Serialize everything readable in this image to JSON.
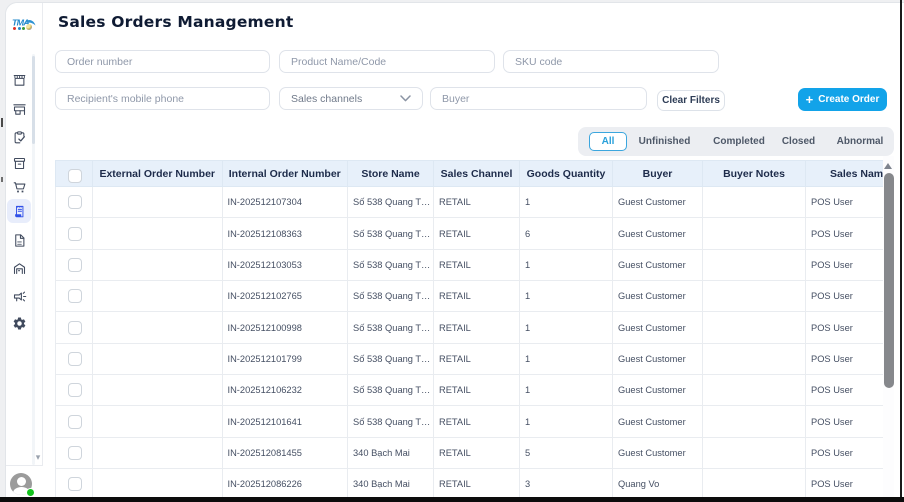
{
  "colors": {
    "accent_blue": "#12a3e9",
    "active_nav_blue": "#3050e8",
    "tab_active_blue": "#29a0da",
    "table_header_bg": "#e7f0fa",
    "status_green": "#14c31e"
  },
  "sidebar": {
    "logo_text": "TMA",
    "scroll_down_glyph": "▾",
    "nav_items": [
      {
        "icon": "storefront-icon",
        "active": false
      },
      {
        "icon": "pos-terminal-icon",
        "active": false
      },
      {
        "icon": "clipboard-check-icon",
        "active": false
      },
      {
        "icon": "archive-box-icon",
        "active": false
      },
      {
        "icon": "shopping-cart-icon",
        "active": false
      },
      {
        "icon": "receipt-icon",
        "active": true
      },
      {
        "icon": "document-icon",
        "active": false
      },
      {
        "icon": "warehouse-icon",
        "active": false
      },
      {
        "icon": "megaphone-icon",
        "active": false
      },
      {
        "icon": "gear-icon",
        "active": false
      }
    ]
  },
  "header": {
    "title": "Sales Orders Management"
  },
  "filters": {
    "order_number_placeholder": "Order number",
    "product_placeholder": "Product Name/Code",
    "sku_placeholder": "SKU code",
    "recipient_placeholder": "Recipient's mobile phone",
    "sales_channels_label": "Sales channels",
    "buyer_placeholder": "Buyer",
    "clear_button": "Clear Filters",
    "create_button": "Create Order",
    "create_plus": "+"
  },
  "tabs": [
    {
      "label": "All",
      "active": true
    },
    {
      "label": "Unfinished",
      "active": false
    },
    {
      "label": "Completed",
      "active": false
    },
    {
      "label": "Closed",
      "active": false
    },
    {
      "label": "Abnormal",
      "active": false
    }
  ],
  "table": {
    "columns": [
      "",
      "External Order Number",
      "Internal Order Number",
      "Store Name",
      "Sales Channel",
      "Goods Quantity",
      "Buyer",
      "Buyer Notes",
      "Sales Name"
    ],
    "rows": [
      {
        "external": "",
        "internal": "IN-202512107304",
        "store": "Số 538 Quang T…",
        "channel": "RETAIL",
        "qty": "1",
        "buyer": "Guest Customer",
        "notes": "",
        "sales": "POS User"
      },
      {
        "external": "",
        "internal": "IN-202512108363",
        "store": "Số 538 Quang T…",
        "channel": "RETAIL",
        "qty": "6",
        "buyer": "Guest Customer",
        "notes": "",
        "sales": "POS User"
      },
      {
        "external": "",
        "internal": "IN-202512103053",
        "store": "Số 538 Quang T…",
        "channel": "RETAIL",
        "qty": "1",
        "buyer": "Guest Customer",
        "notes": "",
        "sales": "POS User"
      },
      {
        "external": "",
        "internal": "IN-202512102765",
        "store": "Số 538 Quang T…",
        "channel": "RETAIL",
        "qty": "1",
        "buyer": "Guest Customer",
        "notes": "",
        "sales": "POS User"
      },
      {
        "external": "",
        "internal": "IN-202512100998",
        "store": "Số 538 Quang T…",
        "channel": "RETAIL",
        "qty": "1",
        "buyer": "Guest Customer",
        "notes": "",
        "sales": "POS User"
      },
      {
        "external": "",
        "internal": "IN-202512101799",
        "store": "Số 538 Quang T…",
        "channel": "RETAIL",
        "qty": "1",
        "buyer": "Guest Customer",
        "notes": "",
        "sales": "POS User"
      },
      {
        "external": "",
        "internal": "IN-202512106232",
        "store": "Số 538 Quang T…",
        "channel": "RETAIL",
        "qty": "1",
        "buyer": "Guest Customer",
        "notes": "",
        "sales": "POS User"
      },
      {
        "external": "",
        "internal": "IN-202512101641",
        "store": "Số 538 Quang T…",
        "channel": "RETAIL",
        "qty": "1",
        "buyer": "Guest Customer",
        "notes": "",
        "sales": "POS User"
      },
      {
        "external": "",
        "internal": "IN-202512081455",
        "store": "340 Bạch Mai",
        "channel": "RETAIL",
        "qty": "5",
        "buyer": "Guest Customer",
        "notes": "",
        "sales": "POS User"
      },
      {
        "external": "",
        "internal": "IN-202512086226",
        "store": "340 Bạch Mai",
        "channel": "RETAIL",
        "qty": "3",
        "buyer": "Quang Vo",
        "notes": "",
        "sales": "POS User"
      }
    ]
  }
}
